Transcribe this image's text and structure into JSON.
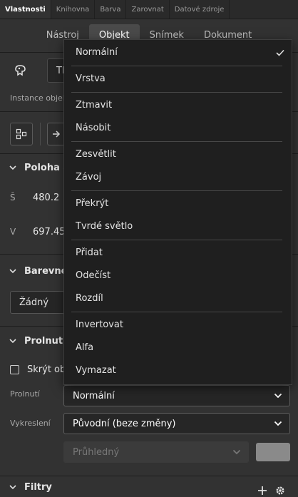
{
  "panel_tabs": [
    "Vlastnosti",
    "Knihovna",
    "Barva",
    "Zarovnat",
    "Datové zdroje"
  ],
  "sub_tabs": [
    "Nástroj",
    "Objekt",
    "Snímek",
    "Dokument"
  ],
  "symbol": {
    "icon": "symbol-icon",
    "type_value": "Tl"
  },
  "instance_label": "Instance objekt",
  "position_section": {
    "title": "Poloha a",
    "w_label": "Š",
    "w_value": "480.2",
    "h_label": "V",
    "h_value": "697.45"
  },
  "color_section": {
    "title": "Barevné",
    "effect_value": "Žádný"
  },
  "blend_section": {
    "title": "Prolnutí",
    "hide_label": "Skrýt obj",
    "blend_label": "Prolnutí",
    "blend_value": "Normální",
    "render_label": "Vykreslení",
    "render_value": "Původní (beze změny)",
    "transparent_value": "Průhledný",
    "swatch_color": "#8a8a8a"
  },
  "filters_section": {
    "title": "Filtry"
  },
  "blend_menu": {
    "selected": "Normální",
    "groups": [
      [
        "Normální"
      ],
      [
        "Vrstva"
      ],
      [
        "Ztmavit",
        "Násobit"
      ],
      [
        "Zesvětlit",
        "Závoj"
      ],
      [
        "Překrýt",
        "Tvrdé světlo"
      ],
      [
        "Přidat",
        "Odečíst",
        "Rozdíl"
      ],
      [
        "Invertovat",
        "Alfa",
        "Vymazat"
      ]
    ]
  },
  "colors": {
    "panel_bg": "#323232",
    "popup_bg": "#1f1f1f",
    "text": "#e0e0e0"
  }
}
